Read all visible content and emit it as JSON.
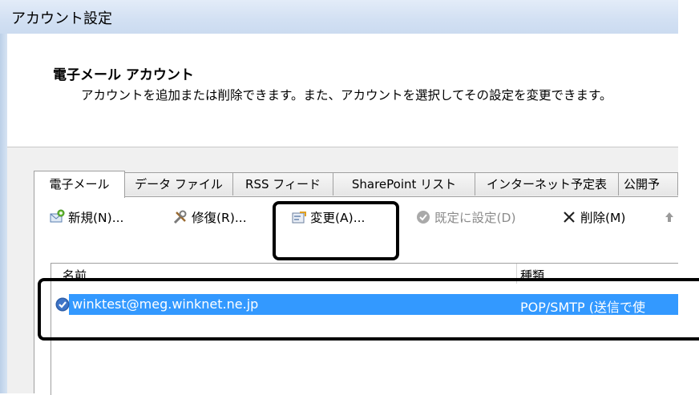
{
  "window": {
    "title": "アカウント設定"
  },
  "header": {
    "title": "電子メール アカウント",
    "description": "アカウントを追加または削除できます。また、アカウントを選択してその設定を変更できます。"
  },
  "tabs": [
    {
      "label": "電子メール"
    },
    {
      "label": "データ ファイル"
    },
    {
      "label": "RSS フィード"
    },
    {
      "label": "SharePoint リスト"
    },
    {
      "label": "インターネット予定表"
    },
    {
      "label": "公開予"
    }
  ],
  "toolbar": {
    "new_label": "新規(N)...",
    "repair_label": "修復(R)...",
    "change_label": "変更(A)...",
    "set_default_label": "既定に設定(D)",
    "delete_label": "削除(M)",
    "icons": {
      "new": "new-account-icon",
      "repair": "repair-tools-icon",
      "change": "change-settings-icon",
      "set_default": "checkmark-circle-icon",
      "delete": "x-delete-icon",
      "move_up": "arrow-up-icon"
    }
  },
  "list": {
    "columns": [
      "名前",
      "種類"
    ],
    "rows": [
      {
        "name": "winktest@meg.winknet.ne.jp",
        "type": "POP/SMTP (送信で使"
      }
    ]
  },
  "colors": {
    "selection": "#3399ff",
    "highlight_border": "#000000",
    "title_bar": "#d2e0f3"
  }
}
